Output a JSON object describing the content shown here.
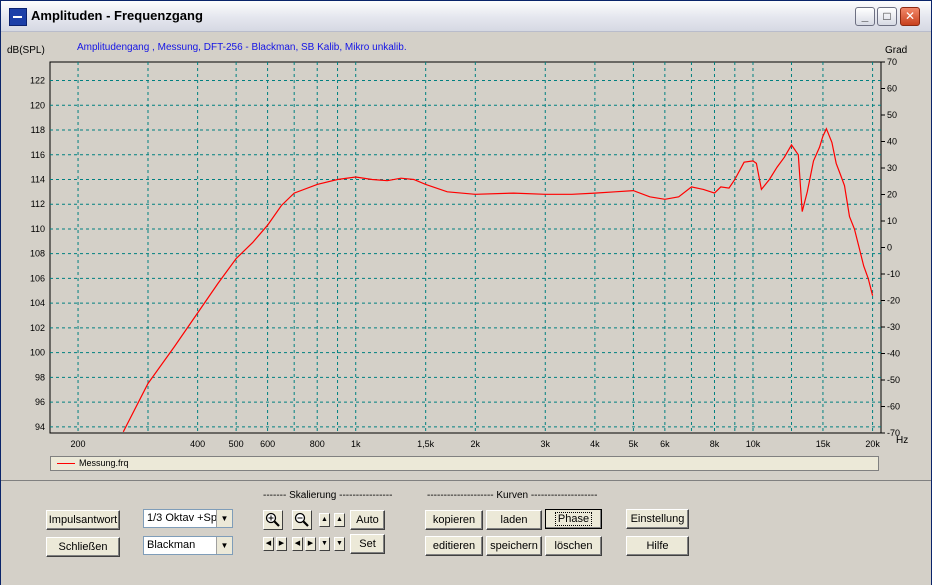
{
  "window": {
    "title": "Amplituden - Frequenzgang",
    "icon": "app-icon",
    "buttons": {
      "minimize": "_",
      "maximize": "□",
      "close": "✕"
    }
  },
  "chart": {
    "subtitle": "Amplitudengang , Messung, DFT-256 - Blackman, SB Kalib, Mikro unkalib.",
    "ylabel_left": "dB(SPL)",
    "ylabel_right": "Grad",
    "xunit": "Hz",
    "legend": "Messung.frq"
  },
  "chart_data": {
    "type": "line",
    "title": "Amplitudengang , Messung, DFT-256 - Blackman, SB Kalib, Mikro unkalib.",
    "xlabel": "Hz",
    "ylabel": "dB(SPL)",
    "y2label": "Grad",
    "xscale": "log",
    "xlim": [
      170,
      21000
    ],
    "ylim": [
      93.5,
      123.5
    ],
    "y2lim": [
      -70,
      70
    ],
    "grid": true,
    "legend_position": "bottom",
    "x_ticks": [
      {
        "v": 200,
        "label": "200"
      },
      {
        "v": 400,
        "label": "400"
      },
      {
        "v": 500,
        "label": "500"
      },
      {
        "v": 600,
        "label": "600"
      },
      {
        "v": 800,
        "label": "800"
      },
      {
        "v": 1000,
        "label": "1k"
      },
      {
        "v": 1500,
        "label": "1,5k"
      },
      {
        "v": 2000,
        "label": "2k"
      },
      {
        "v": 3000,
        "label": "3k"
      },
      {
        "v": 4000,
        "label": "4k"
      },
      {
        "v": 5000,
        "label": "5k"
      },
      {
        "v": 6000,
        "label": "6k"
      },
      {
        "v": 8000,
        "label": "8k"
      },
      {
        "v": 10000,
        "label": "10k"
      },
      {
        "v": 15000,
        "label": "15k"
      },
      {
        "v": 20000,
        "label": "20k"
      }
    ],
    "x_minor": [
      300,
      700,
      900,
      7000,
      9000,
      12500
    ],
    "y_ticks": [
      94,
      96,
      98,
      100,
      102,
      104,
      106,
      108,
      110,
      112,
      114,
      116,
      118,
      120,
      122
    ],
    "y2_ticks": [
      -70,
      -60,
      -50,
      -40,
      -30,
      -20,
      -10,
      0,
      10,
      20,
      30,
      40,
      50,
      60,
      70
    ],
    "series": [
      {
        "name": "Messung.frq",
        "color": "#ff0000",
        "x": [
          260,
          300,
          350,
          400,
          450,
          500,
          550,
          600,
          650,
          700,
          800,
          900,
          1000,
          1100,
          1200,
          1300,
          1400,
          1500,
          1700,
          2000,
          2500,
          3000,
          3500,
          4000,
          4500,
          5000,
          5500,
          6000,
          6500,
          7000,
          7500,
          8000,
          8300,
          8700,
          9000,
          9500,
          10000,
          10200,
          10500,
          11000,
          11500,
          12000,
          12500,
          13000,
          13300,
          13700,
          14200,
          14700,
          15000,
          15300,
          15800,
          16200,
          16600,
          17000,
          17500,
          18000,
          18500,
          19000,
          19500,
          20000
        ],
        "values": [
          93.6,
          97.5,
          100.5,
          103.2,
          105.6,
          107.6,
          108.9,
          110.3,
          111.9,
          112.9,
          113.6,
          114.0,
          114.2,
          114.0,
          113.9,
          114.1,
          114.0,
          113.6,
          113.0,
          112.8,
          112.9,
          112.8,
          112.8,
          112.9,
          113.0,
          113.1,
          112.6,
          112.4,
          112.6,
          113.4,
          113.2,
          112.9,
          113.4,
          113.3,
          114.0,
          115.4,
          115.5,
          115.3,
          113.2,
          114.0,
          115.0,
          115.8,
          116.8,
          116.0,
          111.4,
          113.0,
          115.5,
          116.6,
          117.5,
          118.1,
          117.0,
          115.3,
          114.4,
          113.5,
          111.0,
          110.0,
          108.5,
          107.0,
          106.0,
          104.6
        ]
      }
    ]
  },
  "controls": {
    "impulse_button": "Impulsantwort",
    "close_button": "Schließen",
    "octave_select": "1/3 Oktav +Sp",
    "window_select": "Blackman",
    "scaling_label": "------- Skalierung ----------------",
    "auto_button": "Auto",
    "set_button": "Set",
    "curves_label": "-------------------- Kurven --------------------",
    "copy_button": "kopieren",
    "load_button": "laden",
    "phase_button": "Phase",
    "edit_button": "editieren",
    "save_button": "speichern",
    "delete_button": "löschen",
    "settings_button": "Einstellung",
    "help_button": "Hilfe",
    "zoom_in_glyph": "+",
    "zoom_out_glyph": "−",
    "arrow_up": "▲",
    "arrow_down": "▼",
    "arrow_left": "◀",
    "arrow_right": "▶"
  }
}
